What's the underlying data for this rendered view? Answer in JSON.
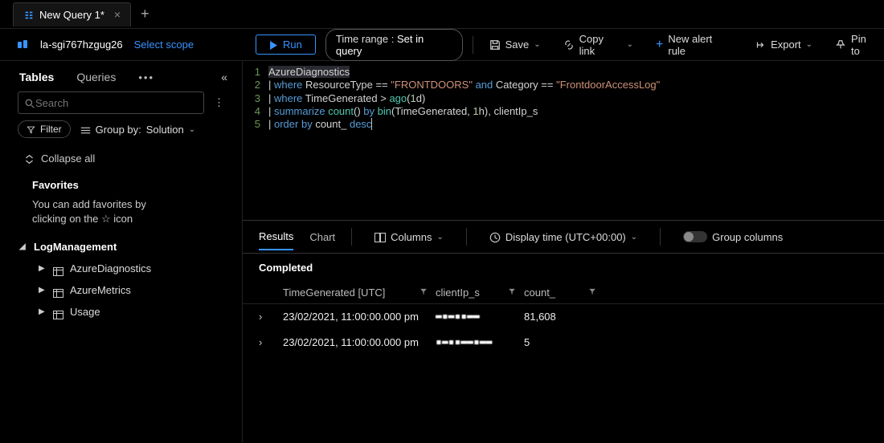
{
  "tab": {
    "title": "New Query 1*"
  },
  "scope": {
    "workspace": "la-sgi767hzgug26",
    "select": "Select scope"
  },
  "toolbar": {
    "run": "Run",
    "timerange_label": "Time range :",
    "timerange_value": "Set in query",
    "save": "Save",
    "copylink": "Copy link",
    "newalert": "New alert rule",
    "export": "Export",
    "pin": "Pin to"
  },
  "sidebar": {
    "tabs": {
      "tables": "Tables",
      "queries": "Queries"
    },
    "search_placeholder": "Search",
    "filter": "Filter",
    "groupby_label": "Group by:",
    "groupby_value": "Solution",
    "collapse": "Collapse all",
    "favorites_header": "Favorites",
    "favorites_text": "You can add favorites by clicking on the ☆ icon",
    "tree": {
      "root": "LogManagement",
      "children": [
        "AzureDiagnostics",
        "AzureMetrics",
        "Usage"
      ]
    }
  },
  "editor": {
    "lines": [
      {
        "n": "1",
        "tokens": [
          [
            "c-white code-sel",
            "AzureDiagnostics"
          ]
        ]
      },
      {
        "n": "2",
        "tokens": [
          [
            "c-white",
            "| "
          ],
          [
            "c-blue",
            "where"
          ],
          [
            "c-white",
            " ResourceType "
          ],
          [
            "c-white",
            "=="
          ],
          [
            "c-white",
            " "
          ],
          [
            "c-orange",
            "\"FRONTDOORS\""
          ],
          [
            "c-white",
            " "
          ],
          [
            "c-blue",
            "and"
          ],
          [
            "c-white",
            " Category "
          ],
          [
            "c-white",
            "=="
          ],
          [
            "c-white",
            " "
          ],
          [
            "c-orange",
            "\"FrontdoorAccessLog\""
          ]
        ]
      },
      {
        "n": "3",
        "tokens": [
          [
            "c-white",
            "| "
          ],
          [
            "c-blue",
            "where"
          ],
          [
            "c-white",
            " TimeGenerated > "
          ],
          [
            "c-cyan",
            "ago"
          ],
          [
            "c-white",
            "("
          ],
          [
            "c-green",
            "1"
          ],
          [
            "c-white",
            "d)"
          ]
        ]
      },
      {
        "n": "4",
        "tokens": [
          [
            "c-white",
            "| "
          ],
          [
            "c-blue",
            "summarize"
          ],
          [
            "c-white",
            " "
          ],
          [
            "c-cyan",
            "count"
          ],
          [
            "c-white",
            "() "
          ],
          [
            "c-blue",
            "by"
          ],
          [
            "c-white",
            " "
          ],
          [
            "c-cyan",
            "bin"
          ],
          [
            "c-white",
            "(TimeGenerated, "
          ],
          [
            "c-green",
            "1"
          ],
          [
            "c-white",
            "h), clientIp_s"
          ]
        ]
      },
      {
        "n": "5",
        "tokens": [
          [
            "c-white",
            "| "
          ],
          [
            "c-blue",
            "order by"
          ],
          [
            "c-white",
            " count_ "
          ],
          [
            "c-blue cursor-bar",
            "desc"
          ]
        ]
      }
    ]
  },
  "results": {
    "tabs": {
      "results": "Results",
      "chart": "Chart"
    },
    "columns_btn": "Columns",
    "displaytime": "Display time (UTC+00:00)",
    "groupcols": "Group columns",
    "status": "Completed",
    "headers": {
      "time": "TimeGenerated [UTC]",
      "ip": "clientIp_s",
      "count": "count_"
    },
    "rows": [
      {
        "time": "23/02/2021, 11:00:00.000 pm",
        "ip": "▬▪▬▪▪▬▬",
        "count": "81,608"
      },
      {
        "time": "23/02/2021, 11:00:00.000 pm",
        "ip": "▪▬▪▪▬▬▪▬▬",
        "count": "5"
      }
    ]
  }
}
